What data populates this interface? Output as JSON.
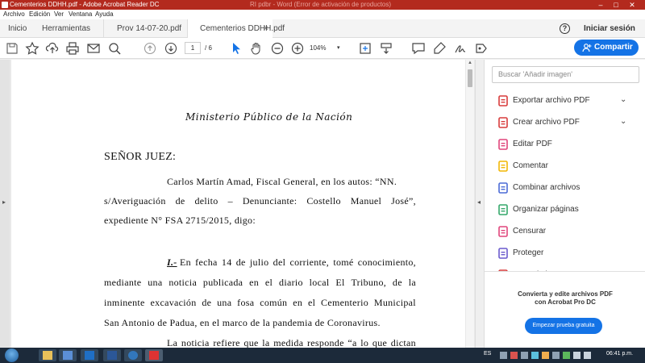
{
  "window": {
    "title": "Cementerios DDHH.pdf - Adobe Acrobat Reader DC",
    "blurred_title": "RI pdbr - Word (Error de activación de productos)",
    "controls": [
      "–",
      "□",
      "✕"
    ]
  },
  "menu": [
    "Archivo",
    "Edición",
    "Ver",
    "Ventana",
    "Ayuda"
  ],
  "tabs": {
    "home": "Inicio",
    "tools": "Herramientas",
    "docs": [
      {
        "label": "Prov 14-07-20.pdf"
      },
      {
        "label": "Cementerios DDHH.pdf",
        "active": true
      }
    ],
    "close_glyph": "×",
    "help": "?",
    "signin": "Iniciar sesión"
  },
  "toolbar": {
    "page_current": "1",
    "page_total": "/ 6",
    "zoom": "104%",
    "share_label": "Compartir",
    "icons": [
      "save-icon",
      "star-icon",
      "upload-icon",
      "print-icon",
      "email-icon",
      "zoom-search-icon",
      "page-up-icon",
      "page-down-icon",
      "select-cursor-icon",
      "hand-icon",
      "zoom-out-icon",
      "zoom-in-icon",
      "zoom-dropdown-icon",
      "fit-page-icon",
      "scroll-mode-icon",
      "comment-icon",
      "highlight-icon",
      "sign-icon",
      "fill-sign-icon"
    ]
  },
  "document": {
    "header": "Ministerio Público de la Nación",
    "greeting": "SEÑOR JUEZ:",
    "para1": {
      "line1": [
        "Carlos Martín Amad, Fiscal General, en los autos: “NN."
      ],
      "line2": [
        "s/Averiguación",
        "de",
        "delito",
        "–",
        "Denunciante:",
        "Costello",
        "Manuel",
        "José”,"
      ],
      "line3": "expediente N° FSA 2715/2015, digo:"
    },
    "para2": {
      "num": "I.-",
      "line1": [
        "En",
        "fecha",
        "14",
        "de",
        "julio",
        "del",
        "corriente,",
        "tomé",
        "conocimiento,"
      ],
      "line2": [
        "mediante",
        "una",
        "noticia",
        "publicada",
        "en",
        "el",
        "diario",
        "local",
        "El",
        "Tribuno,",
        "de",
        "la"
      ],
      "line3": [
        "inminente",
        "excavación",
        "de",
        "una",
        "fosa",
        "común",
        "en",
        "el",
        "Cementerio",
        "Municipal"
      ],
      "line4": "San Antonio de Padua, en el marco de la pandemia de Coronavirus."
    },
    "para3_line1": [
      "La",
      "noticia",
      "refiere",
      "que",
      "la",
      "medida",
      "responde",
      "“a",
      "lo",
      "que",
      "dictan"
    ]
  },
  "right_pane": {
    "search_placeholder": "Buscar 'Añadir imagen'",
    "tools": [
      {
        "label": "Exportar archivo PDF",
        "icon": "export-pdf-icon",
        "color": "#d83b3b",
        "expandable": true
      },
      {
        "label": "Crear archivo PDF",
        "icon": "create-pdf-icon",
        "color": "#d83b3b",
        "expandable": true
      },
      {
        "label": "Editar PDF",
        "icon": "edit-pdf-icon",
        "color": "#e0457b"
      },
      {
        "label": "Comentar",
        "icon": "comment-icon",
        "color": "#f2b705"
      },
      {
        "label": "Combinar archivos",
        "icon": "combine-files-icon",
        "color": "#4b6bd6"
      },
      {
        "label": "Organizar páginas",
        "icon": "organize-pages-icon",
        "color": "#35a86b"
      },
      {
        "label": "Censurar",
        "icon": "redact-icon",
        "color": "#e0457b"
      },
      {
        "label": "Proteger",
        "icon": "protect-icon",
        "color": "#6a5acd"
      },
      {
        "label": "Comprimir PDF",
        "icon": "compress-pdf-icon",
        "color": "#d83b3b"
      }
    ],
    "promo_line1": "Convierta y edite archivos PDF",
    "promo_line2": "con Acrobat Pro DC",
    "trial_button": "Empezar prueba gratuita"
  },
  "taskbar": {
    "apps": [
      "explorer-icon",
      "media-icon",
      "outlook-icon",
      "word-icon",
      "edge-icon",
      "acrobat-icon"
    ],
    "language": "ES",
    "clock": "06:41 p.m."
  }
}
